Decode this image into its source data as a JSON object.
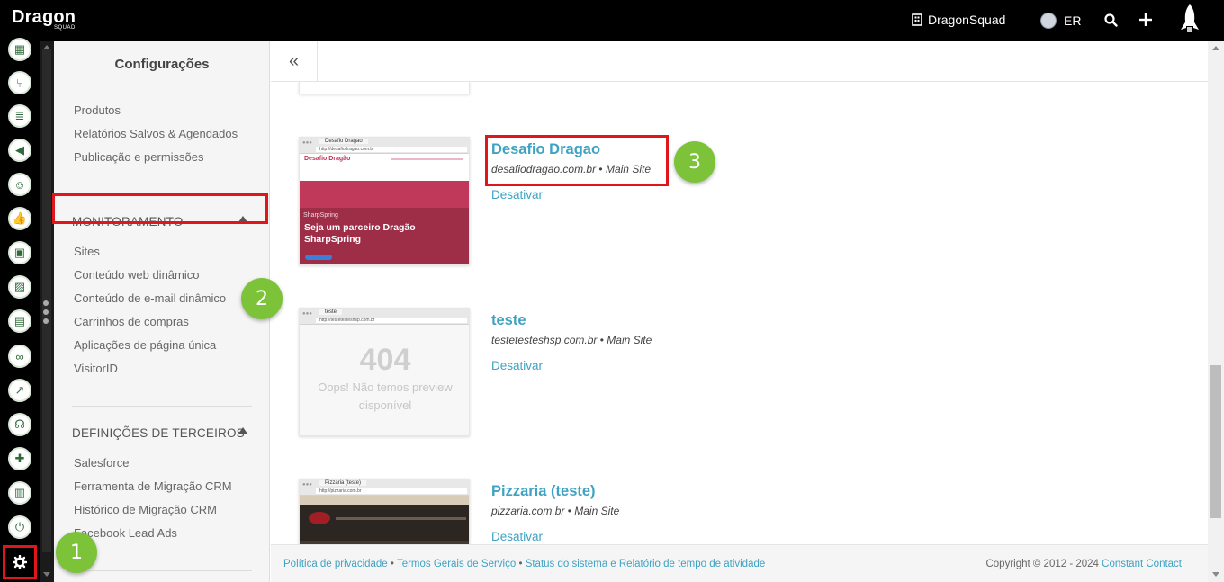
{
  "brand": {
    "logo_text": "Dragon",
    "logo_sub": "SQUAD"
  },
  "topbar": {
    "org_name": "DragonSquad",
    "user_initials": "ER",
    "org_icon": "building-icon",
    "search_icon": "search-icon",
    "add_icon": "plus-icon",
    "rocket_icon": "rocket-icon"
  },
  "iconbar": {
    "items": [
      "map-icon",
      "branch-icon",
      "list-icon",
      "megaphone-icon",
      "chat-icon",
      "thumbs-up-icon",
      "tv-icon",
      "image-icon",
      "calendar-icon",
      "handshake-icon",
      "trend-chart-icon",
      "headset-icon",
      "add-user-icon",
      "bar-chart-icon",
      "plug-icon"
    ],
    "settings_icon": "gear-icon"
  },
  "settings": {
    "title": "Configurações",
    "general": [
      "Produtos",
      "Relatórios Salvos & Agendados",
      "Publicação e permissões"
    ],
    "monitoring_heading": "MONITORAMENTO",
    "monitoring": [
      "Sites",
      "Conteúdo web dinâmico",
      "Conteúdo de e-mail dinâmico",
      "Carrinhos de compras",
      "Aplicações de página única",
      "VisitorID"
    ],
    "third_party_heading": "DEFINIÇÕES DE TERCEIROS",
    "third_party": [
      "Salesforce",
      "Ferramenta de Migração CRM",
      "Histórico de Migração CRM",
      "Facebook Lead Ads"
    ]
  },
  "main": {
    "collapse_icon": "double-chevron-left-icon",
    "sites": [
      {
        "name": "Desafio Dragao",
        "domain": "desafiodragao.com.br",
        "tag": "Main Site",
        "action": "Desativar",
        "preview": {
          "tab": "Desafio Dragao",
          "url": "http://desafiodragao.com.br",
          "header_title": "Desafio Dragão",
          "brand_label": "SharpSpring",
          "headline": "Seja um parceiro Dragão SharpSpring"
        }
      },
      {
        "name": "teste",
        "domain": "testetesteshsp.com.br",
        "tag": "Main Site",
        "action": "Desativar",
        "preview": {
          "tab": "teste",
          "url": "http://testetesteshsp.com.br",
          "code": "404",
          "message": "Oops! Não temos preview disponível"
        }
      },
      {
        "name": "Pizzaria (teste)",
        "domain": "pizzaria.com.br",
        "tag": "Main Site",
        "action": "Desativar",
        "preview": {
          "tab": "Pizzaria (teste)",
          "url": "http://pizzaria.com.br"
        }
      }
    ],
    "separator": "•"
  },
  "badges": [
    "1",
    "2",
    "3"
  ],
  "footer": {
    "privacy": "Política de privacidade",
    "terms": "Termos Gerais de Serviço",
    "status": "Status do sistema e Relatório de tempo de atividade",
    "sep": "•",
    "copyright": "Copyright © 2012 - 2024",
    "company": "Constant Contact"
  },
  "colors": {
    "accent": "#3fa2c3",
    "highlight": "#e0161b",
    "badge": "#7cc33a"
  }
}
